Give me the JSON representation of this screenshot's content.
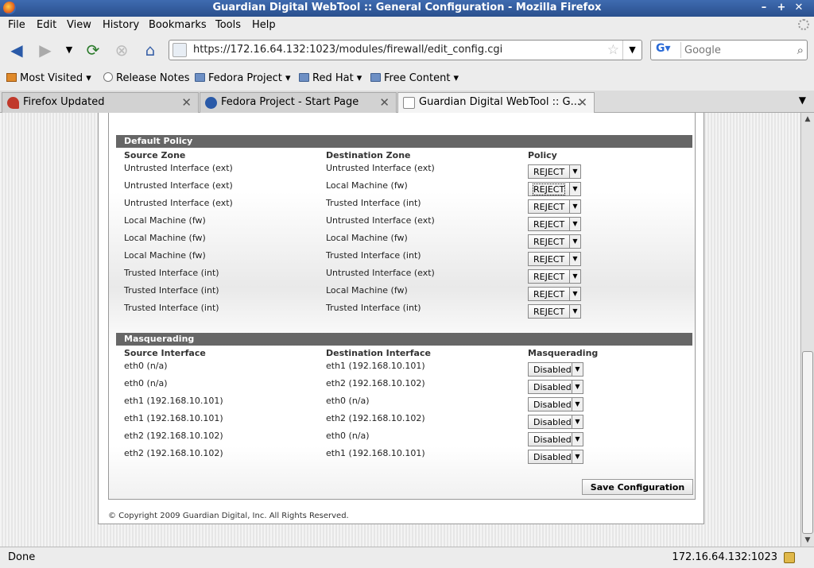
{
  "window": {
    "title": "Guardian Digital WebTool :: General Configuration - Mozilla Firefox"
  },
  "menu": [
    "File",
    "Edit",
    "View",
    "History",
    "Bookmarks",
    "Tools",
    "Help"
  ],
  "nav": {
    "url": "https://172.16.64.132:1023/modules/firewall/edit_config.cgi",
    "search_placeholder": "Google"
  },
  "bookmarks": [
    {
      "label": "Most Visited",
      "icon": "most-visited-icon",
      "dropdown": true
    },
    {
      "label": "Release Notes",
      "icon": "page-icon",
      "dropdown": false
    },
    {
      "label": "Fedora Project",
      "icon": "folder-icon",
      "dropdown": true
    },
    {
      "label": "Red Hat",
      "icon": "folder-icon",
      "dropdown": true
    },
    {
      "label": "Free Content",
      "icon": "folder-icon",
      "dropdown": true
    }
  ],
  "tabs": [
    {
      "label": "Firefox Updated",
      "active": false
    },
    {
      "label": "Fedora Project - Start Page",
      "active": false
    },
    {
      "label": "Guardian Digital WebTool :: G...",
      "active": true
    }
  ],
  "default_policy": {
    "title": "Default Policy",
    "headers": {
      "source": "Source Zone",
      "dest": "Destination Zone",
      "policy": "Policy"
    },
    "rows": [
      {
        "source": "Untrusted Interface (ext)",
        "dest": "Untrusted Interface (ext)",
        "policy": "REJECT"
      },
      {
        "source": "Untrusted Interface (ext)",
        "dest": "Local Machine (fw)",
        "policy": "REJECT"
      },
      {
        "source": "Untrusted Interface (ext)",
        "dest": "Trusted Interface (int)",
        "policy": "REJECT"
      },
      {
        "source": "Local Machine (fw)",
        "dest": "Untrusted Interface (ext)",
        "policy": "REJECT"
      },
      {
        "source": "Local Machine (fw)",
        "dest": "Local Machine (fw)",
        "policy": "REJECT"
      },
      {
        "source": "Local Machine (fw)",
        "dest": "Trusted Interface (int)",
        "policy": "REJECT"
      },
      {
        "source": "Trusted Interface (int)",
        "dest": "Untrusted Interface (ext)",
        "policy": "REJECT"
      },
      {
        "source": "Trusted Interface (int)",
        "dest": "Local Machine (fw)",
        "policy": "REJECT"
      },
      {
        "source": "Trusted Interface (int)",
        "dest": "Trusted Interface (int)",
        "policy": "REJECT"
      }
    ]
  },
  "masquerading": {
    "title": "Masquerading",
    "headers": {
      "source": "Source Interface",
      "dest": "Destination Interface",
      "value": "Masquerading"
    },
    "rows": [
      {
        "source": "eth0 (n/a)",
        "dest": "eth1 (192.168.10.101)",
        "value": "Disabled"
      },
      {
        "source": "eth0 (n/a)",
        "dest": "eth2 (192.168.10.102)",
        "value": "Disabled"
      },
      {
        "source": "eth1 (192.168.10.101)",
        "dest": "eth0 (n/a)",
        "value": "Disabled"
      },
      {
        "source": "eth1 (192.168.10.101)",
        "dest": "eth2 (192.168.10.102)",
        "value": "Disabled"
      },
      {
        "source": "eth2 (192.168.10.102)",
        "dest": "eth0 (n/a)",
        "value": "Disabled"
      },
      {
        "source": "eth2 (192.168.10.102)",
        "dest": "eth1 (192.168.10.101)",
        "value": "Disabled"
      }
    ]
  },
  "save_label": "Save Configuration",
  "copyright": "© Copyright 2009 Guardian Digital, Inc. All Rights Reserved.",
  "status": {
    "text": "Done",
    "host": "172.16.64.132:1023"
  }
}
